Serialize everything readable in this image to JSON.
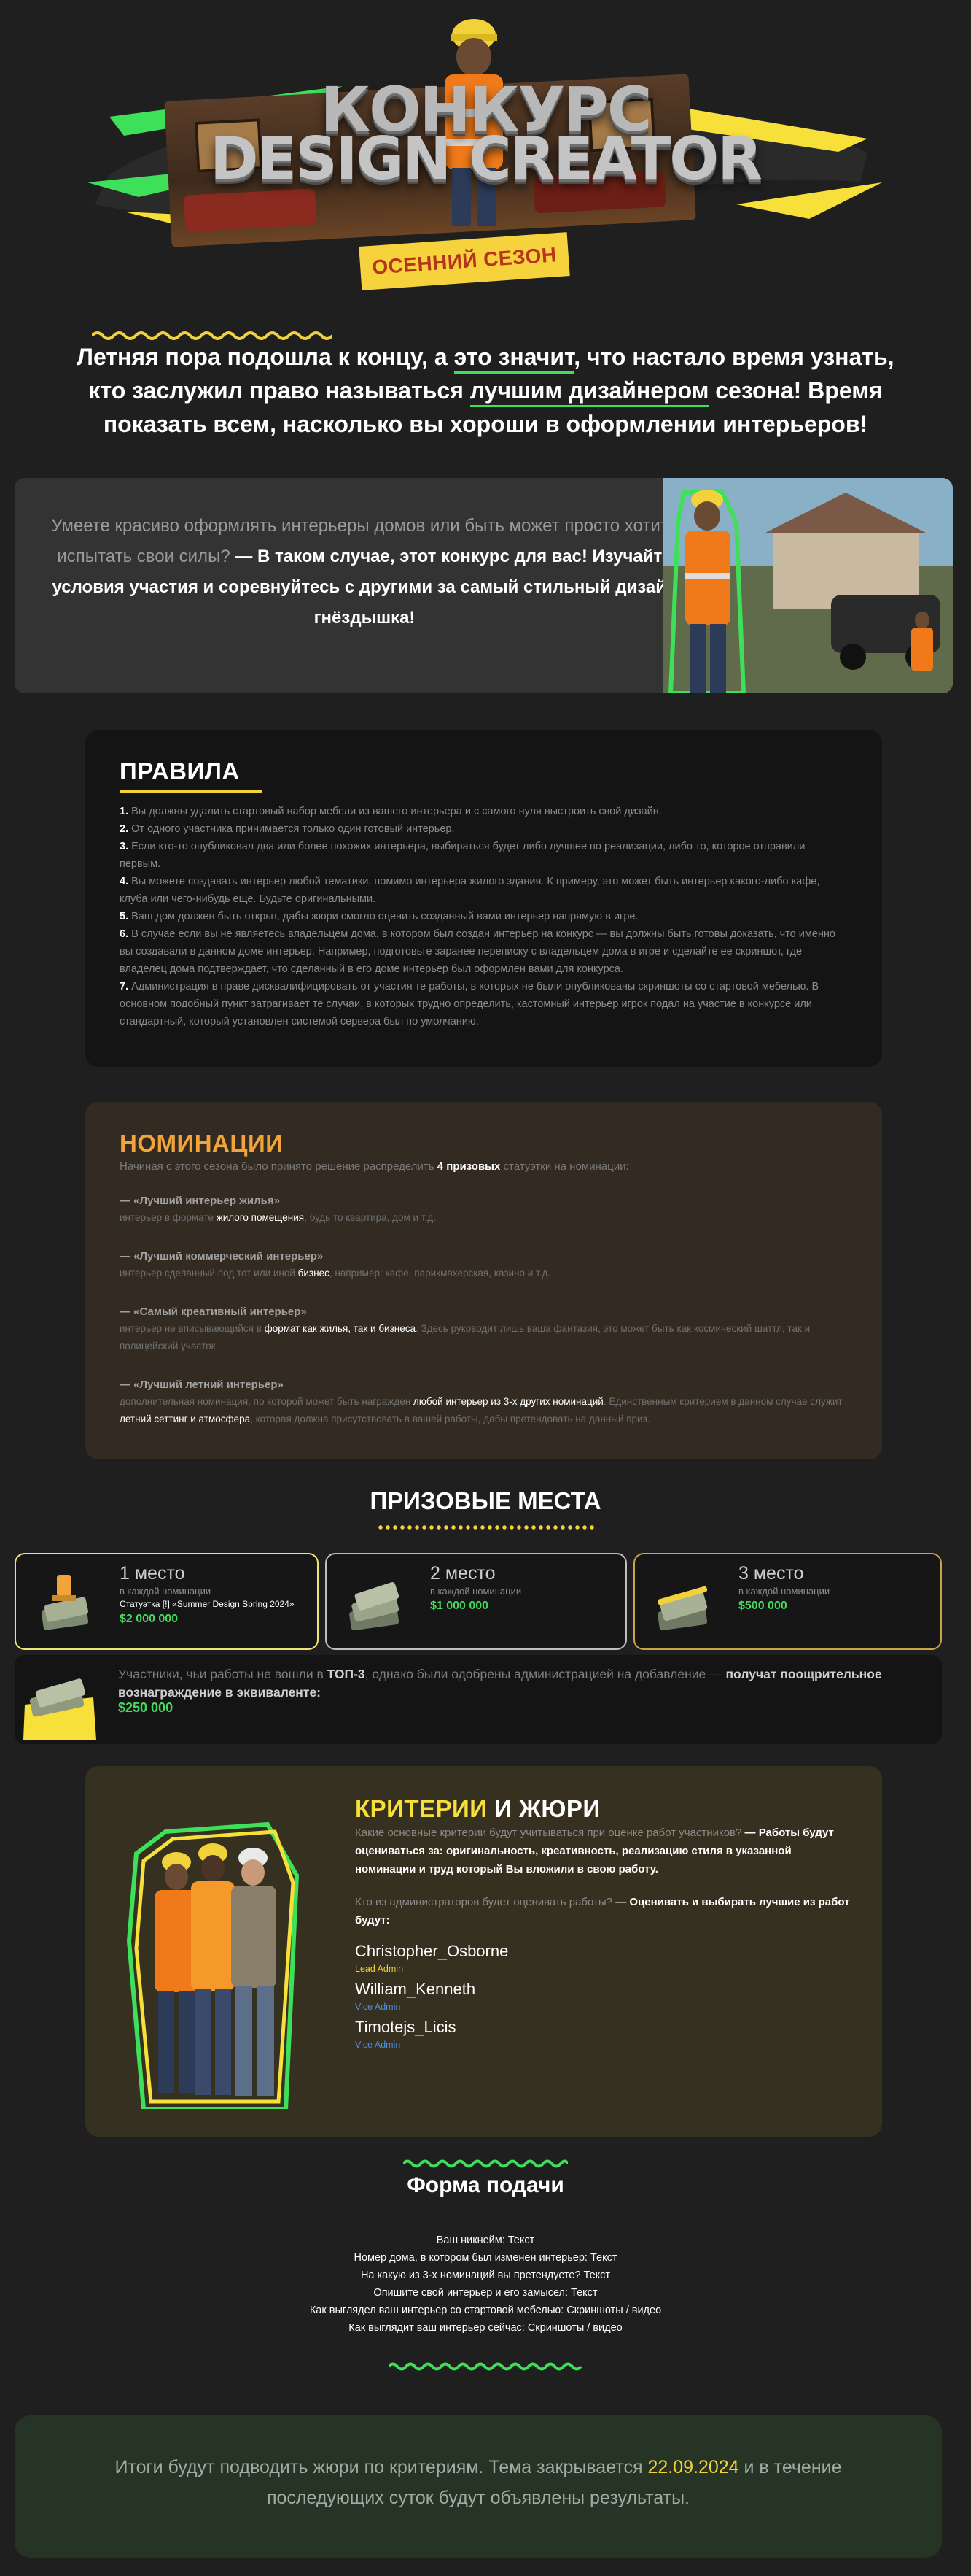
{
  "banner": {
    "title_line1": "КОНКУРС",
    "title_line2": "DESIGN CREATOR",
    "season": "ОСЕННИЙ СЕЗОН"
  },
  "intro": {
    "p1": "Летняя пора подошла к концу, а ",
    "u1": "это значит",
    "p2": ", что настало время узнать, кто заслужил право называться ",
    "u2": "лучшим дизайнером",
    "p3": " сезона! Время показать всем, насколько вы хороши в оформлении интерьеров!"
  },
  "hero": {
    "muted": "Умеете красиво оформлять интерьеры домов или быть может просто хотите испытать свои силы?",
    "bright": " — В таком случае, этот конкурс для вас! Изучайте условия участия и соревнуйтесь с другими за самый стильный дизайн гнёздышка!"
  },
  "rules": {
    "title": "ПРАВИЛА",
    "items": [
      {
        "n": "1.",
        "t": " Вы должны удалить стартовый набор мебели из вашего интерьера и с самого нуля выстроить свой дизайн."
      },
      {
        "n": "2.",
        "t": " От одного участника принимается только один готовый интерьер."
      },
      {
        "n": "3.",
        "t": " Если кто-то опубликовал два или более похожих интерьера, выбираться будет либо лучшее по реализации, либо то, которое отправили первым."
      },
      {
        "n": "4.",
        "t": " Вы можете создавать интерьер любой тематики, помимо интерьера жилого здания. К примеру, это может быть интерьер какого-либо кафе, клуба или чего-нибудь еще. Будьте оригинальными."
      },
      {
        "n": "5.",
        "t": " Ваш дом должен быть открыт, дабы жюри смогло оценить созданный вами интерьер напрямую в игре."
      },
      {
        "n": "6.",
        "t": " В случае если вы не являетесь владельцем дома, в котором был создан интерьер на конкурс — вы должны быть готовы доказать, что именно вы создавали в данном доме интерьер. Например, подготовьте заранее переписку с владельцем дома в игре и сделайте ее скриншот, где владелец дома подтверждает, что сделанный в его доме интерьер был оформлен вами для конкурса."
      },
      {
        "n": "7.",
        "t": " Администрация в праве дисквалифицировать от участия те работы, в которых не были опубликованы скриншоты со стартовой мебелью. В основном подобный пункт затрагивает те случаи, в которых трудно определить, кастомный интерьер игрок подал на участие в конкурсе или стандартный, который установлен системой сервера был по умолчанию."
      }
    ]
  },
  "nominations": {
    "title": "НОМИНАЦИИ",
    "intro_a": "Начиная с этого сезона было принято решение распределить ",
    "intro_b": "4 призовых",
    "intro_c": " статуэтки на номинации:",
    "items": [
      {
        "title": "— «Лучший интерьер жилья»",
        "a": "интерьер в формате ",
        "b": "жилого помещения",
        "c": ", будь то квартира, дом и т.д.",
        "d": "",
        "e": ""
      },
      {
        "title": "— «Лучший коммерческий интерьер»",
        "a": "интерьер сделанный под тот или иной ",
        "b": "бизнес",
        "c": ", например: кафе, парикмахерская, казино и т.д.",
        "d": "",
        "e": ""
      },
      {
        "title": "— «Самый креативный интерьер»",
        "a": "интерьер не вписывающийся в ",
        "b": "формат как жилья, так и бизнеса",
        "c": ". Здесь руководит лишь ваша фантазия, это может быть как космический шаттл, так и полицейский участок.",
        "d": "",
        "e": ""
      },
      {
        "title": "— «Лучший летний интерьер»",
        "a": "дополнительная номинация, по которой может быть награжден ",
        "b": "любой интерьер из 3-х других номинаций",
        "c": ". Единственным критерием в данном случае служит ",
        "d": "летний сеттинг и атмосфера",
        "e": ", которая должна присутствовать в вашей работы, дабы претендовать на данный приз."
      }
    ]
  },
  "prizes": {
    "title": "ПРИЗОВЫЕ МЕСТА",
    "sub": "в каждой номинации",
    "first": {
      "place": "1 место",
      "status": "Статуэтка [!] «Summer Design Spring 2024»",
      "amount": "$2 000 000"
    },
    "second": {
      "place": "2 место",
      "amount": "$1 000 000"
    },
    "third": {
      "place": "3 место",
      "amount": "$500 000"
    },
    "top3": {
      "a": "Участники, чьи работы не вошли в ",
      "b": "ТОП-3",
      "c": ", однако были одобрены администрацией на добавление — ",
      "d": "получат поощрительное вознаграждение в эквиваленте:",
      "amount": "$250 000"
    }
  },
  "jury": {
    "title_a": "КРИТЕРИИ",
    "title_b": " И ЖЮРИ",
    "q1": "Какие основные критерии будут учитываться при оценке работ участников?",
    "a1": " — Работы будут оцениваться за: оригинальность, креативность, реализацию стиля в указанной номинации и труд который Вы вложили в свою работу.",
    "q2": "Кто из администраторов будет оценивать работы?",
    "a2": " — Оценивать и выбирать лучшие из работ будут:",
    "members": [
      {
        "name": "Christopher_Osborne",
        "role": "Lead Admin"
      },
      {
        "name": "William_Kenneth",
        "role": "Vice Admin"
      },
      {
        "name": "Timotejs_Licis",
        "role": "Vice Admin"
      }
    ]
  },
  "form": {
    "title": "Форма подачи",
    "lines": [
      "Ваш никнейм: Текст",
      "Номер дома, в котором был изменен интерьер: Текст",
      "На какую из 3-х номинаций вы претендуете? Текст",
      "Опишите свой интерьер и его замысел: Текст",
      "Как выглядел ваш интерьер со стартовой мебелью: Скриншоты / видео",
      "Как выглядит ваш интерьер сейчас: Скриншоты / видео"
    ]
  },
  "footer": {
    "a": "Итоги будут подводить жюри по критериям. Тема закрывается ",
    "date": "22.09.2024",
    "b": " и в течение последующих суток будут объявлены результаты."
  },
  "colors": {
    "accent_green": "#45d95f",
    "accent_yellow": "#f2d23a",
    "accent_orange": "#f2a43a",
    "background": "#1f1f1f"
  }
}
